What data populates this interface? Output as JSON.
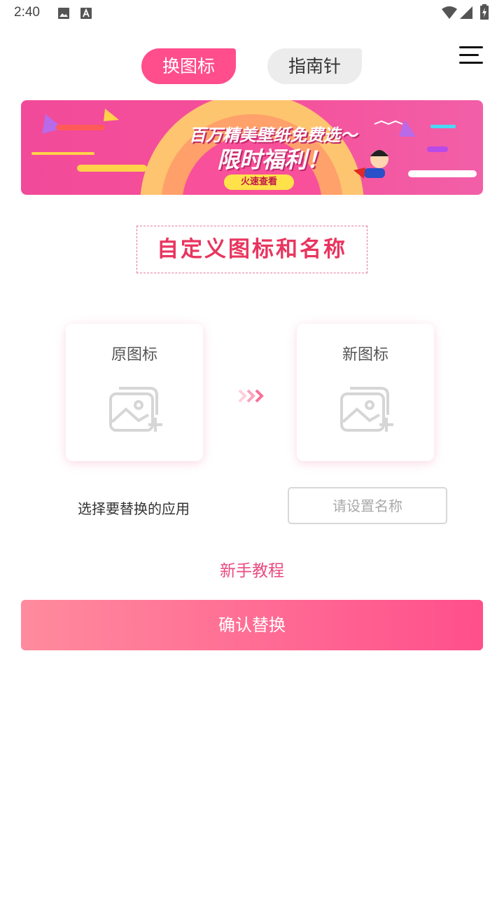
{
  "status_bar": {
    "time": "2:40",
    "icons": [
      "image-icon",
      "font-a-icon",
      "wifi-icon",
      "signal-icon",
      "battery-charging-icon"
    ]
  },
  "tabs": [
    {
      "label": "换图标",
      "active": true
    },
    {
      "label": "指南针",
      "active": false
    }
  ],
  "menu": {
    "icon": "hamburger-menu-icon"
  },
  "banner": {
    "line1": "百万精美壁纸免费选～",
    "line2": "限时福利！",
    "cta": "火速查看"
  },
  "section_title": "自定义图标和名称",
  "cards": {
    "original_label": "原图标",
    "new_label": "新图标",
    "placeholder_icon": "add-image-icon"
  },
  "form": {
    "select_app_label": "选择要替换的应用",
    "name_placeholder": "请设置名称",
    "name_value": ""
  },
  "tutorial_link": "新手教程",
  "confirm_button": "确认替换",
  "colors": {
    "accent": "#ff4e8b",
    "link": "#ea4a80",
    "title": "#e8355f",
    "button_gradient_start": "#ff8b9d",
    "button_gradient_end": "#ff4f8c"
  }
}
